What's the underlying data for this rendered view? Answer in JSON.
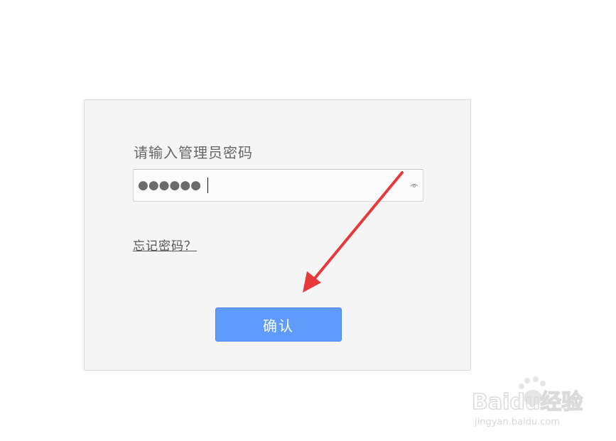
{
  "login": {
    "prompt": "请输入管理员密码",
    "password_mask": "●●●●●●",
    "forgot_link": "忘记密码？",
    "confirm_label": "确认"
  },
  "icons": {
    "password_toggle": "eye-icon",
    "annotation": "red-arrow"
  },
  "colors": {
    "panel_bg": "#f5f5f5",
    "button_bg": "#5e9bfc",
    "arrow": "#e8393a"
  },
  "watermark": {
    "brand": "Baidu经验",
    "url": "jingyan.baidu.com"
  }
}
